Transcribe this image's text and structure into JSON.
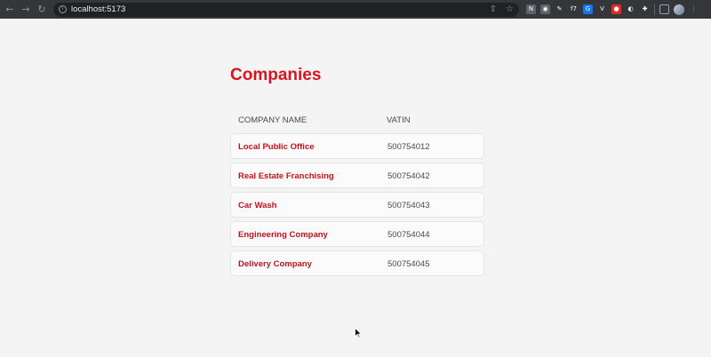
{
  "browser": {
    "url": "localhost:5173",
    "extensions": [
      {
        "icon": "notion-icon",
        "glyph": "N",
        "color": "#5f6368"
      },
      {
        "icon": "camera-icon",
        "glyph": "◉",
        "color": "#5f6368"
      },
      {
        "icon": "pen-icon",
        "glyph": "✎",
        "color": "#35363a"
      },
      {
        "icon": "f7-icon",
        "glyph": "f7",
        "color": "#35363a"
      },
      {
        "icon": "translate-icon",
        "glyph": "G",
        "color": "#1a73e8"
      },
      {
        "icon": "vue-icon",
        "glyph": "V",
        "color": "#35363a"
      },
      {
        "icon": "record-icon",
        "glyph": "●",
        "color": "#d93025"
      },
      {
        "icon": "ghost-icon",
        "glyph": "◐",
        "color": "#35363a"
      },
      {
        "icon": "puzzle-icon",
        "glyph": "✚",
        "color": "#35363a"
      }
    ]
  },
  "page": {
    "title": "Companies",
    "columns": {
      "name": "COMPANY NAME",
      "vatin": "VATIN"
    },
    "companies": [
      {
        "name": "Local Public Office",
        "vatin": "500754012"
      },
      {
        "name": "Real Estate Franchising",
        "vatin": "500754042"
      },
      {
        "name": "Car Wash",
        "vatin": "500754043"
      },
      {
        "name": "Engineering Company",
        "vatin": "500754044"
      },
      {
        "name": "Delivery Company",
        "vatin": "500754045"
      }
    ]
  },
  "colors": {
    "accent": "#d9141c",
    "row_name": "#c8101b",
    "background": "#f4f4f5"
  }
}
